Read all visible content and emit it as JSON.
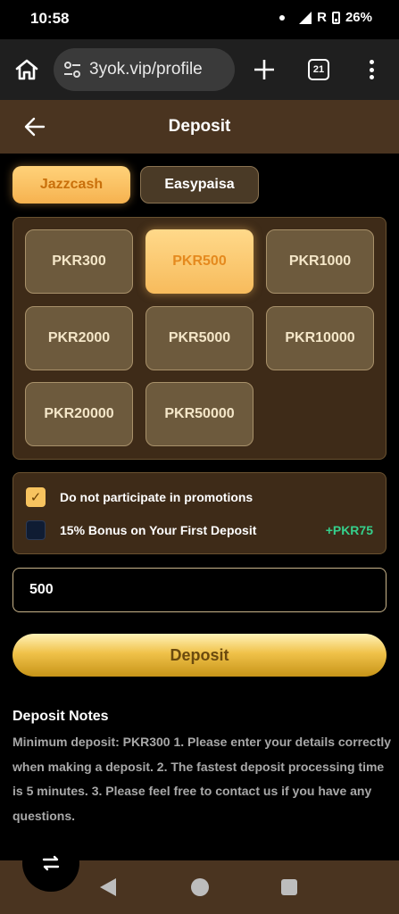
{
  "status_bar": {
    "time": "10:58",
    "carrier_flag": "R",
    "battery": "26%"
  },
  "browser": {
    "url": "3yok.vip/profile",
    "tab_count": "21",
    "icons": [
      "home-icon",
      "site-settings-icon",
      "plus-icon",
      "tab-switcher-icon",
      "more-vert-icon"
    ]
  },
  "header": {
    "title": "Deposit"
  },
  "payment_methods": [
    {
      "label": "Jazzcash",
      "selected": true
    },
    {
      "label": "Easypaisa",
      "selected": false
    }
  ],
  "amounts": [
    {
      "label": "PKR300",
      "selected": false
    },
    {
      "label": "PKR500",
      "selected": true
    },
    {
      "label": "PKR1000",
      "selected": false
    },
    {
      "label": "PKR2000",
      "selected": false
    },
    {
      "label": "PKR5000",
      "selected": false
    },
    {
      "label": "PKR10000",
      "selected": false
    },
    {
      "label": "PKR20000",
      "selected": false
    },
    {
      "label": "PKR50000",
      "selected": false
    }
  ],
  "options": {
    "no_promo": {
      "label": "Do not participate in promotions",
      "checked": true
    },
    "first_bonus": {
      "label": "15% Bonus on Your First Deposit",
      "checked": false,
      "bonus": "+PKR75"
    }
  },
  "amount_field": {
    "value": "500"
  },
  "deposit_button": "Deposit",
  "notes": {
    "title": "Deposit Notes",
    "body": "Minimum deposit: PKR300 1. Please enter your details correctly when making a deposit. 2. The fastest deposit processing time is 5 minutes. 3. Please feel free to contact us if you have any questions."
  },
  "colors": {
    "accent_gold": "#f7bb5c",
    "header_brown": "#4a3420",
    "panel_brown": "#3e2b18",
    "bonus_green": "#35d08c"
  }
}
